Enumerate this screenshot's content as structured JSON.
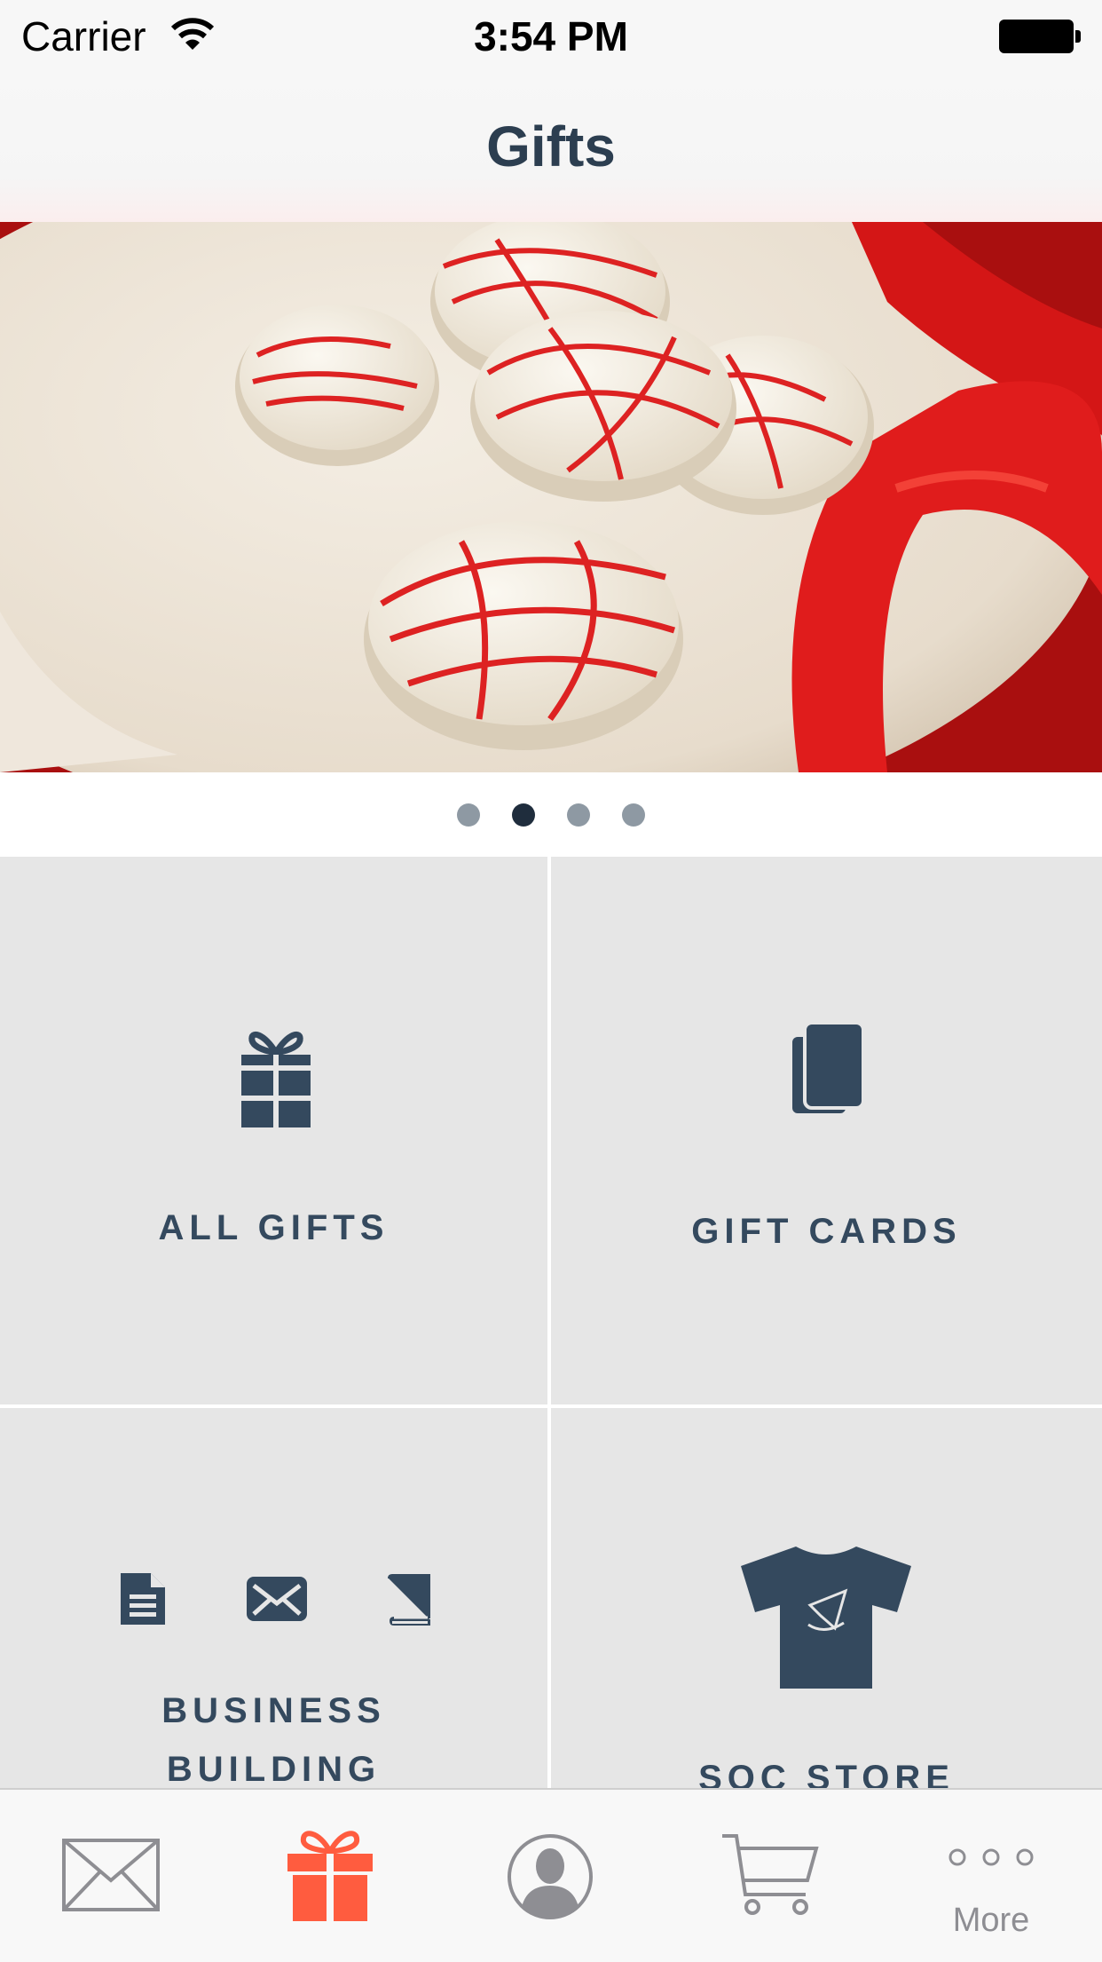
{
  "status_bar": {
    "carrier": "Carrier",
    "time": "3:54 PM"
  },
  "nav": {
    "title": "Gifts"
  },
  "hero": {
    "image": "cookies-with-red-ribbon-photo"
  },
  "carousel": {
    "page_count": 4,
    "active_index": 1
  },
  "tiles": [
    {
      "label": "ALL GIFTS",
      "icon": "gift-icon"
    },
    {
      "label": "GIFT CARDS",
      "icon": "gift-cards-icon"
    },
    {
      "label_lines": [
        "BUSINESS",
        "BUILDING"
      ],
      "icons": [
        "document-icon",
        "envelope-icon",
        "book-icon"
      ]
    },
    {
      "label": "SOC STORE",
      "icon": "tshirt-icon"
    }
  ],
  "tab_bar": {
    "items": [
      {
        "icon": "envelope-icon"
      },
      {
        "icon": "gift-icon",
        "selected": true
      },
      {
        "icon": "profile-icon"
      },
      {
        "icon": "cart-icon"
      },
      {
        "icon": "more-icon",
        "label": "More"
      }
    ]
  },
  "colors": {
    "accent": "#FF5C3F",
    "navy": "#2C3E50",
    "tile_bg": "#E6E6E6",
    "tab_inactive": "#8E8E93"
  }
}
